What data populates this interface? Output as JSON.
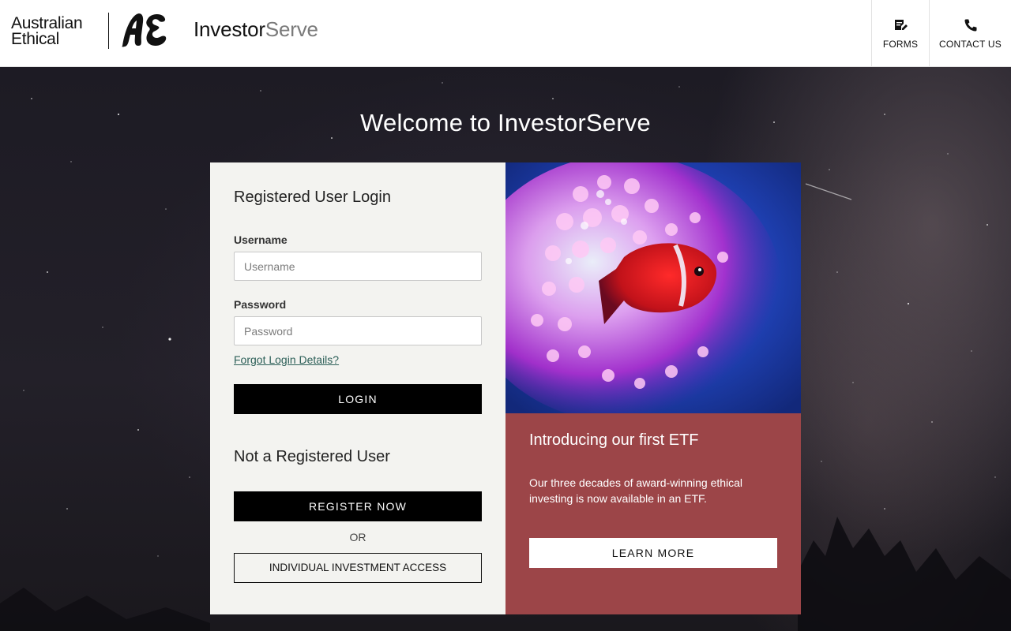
{
  "header": {
    "logo_line1": "Australian",
    "logo_line2": "Ethical",
    "product_name_part1": "Investor",
    "product_name_part2": "Serve",
    "nav": [
      {
        "label": "FORMS",
        "icon": "form-edit-icon"
      },
      {
        "label": "CONTACT US",
        "icon": "phone-icon"
      }
    ]
  },
  "main": {
    "welcome_title": "Welcome to InvestorServe"
  },
  "login": {
    "heading": "Registered User Login",
    "username_label": "Username",
    "username_placeholder": "Username",
    "username_value": "",
    "password_label": "Password",
    "password_placeholder": "Password",
    "password_value": "",
    "forgot_link": "Forgot Login Details?",
    "login_button": "LOGIN"
  },
  "register": {
    "heading": "Not a Registered User",
    "register_button": "REGISTER NOW",
    "or_text": "OR",
    "individual_access_button": "INDIVIDUAL INVESTMENT ACCESS"
  },
  "promo": {
    "title": "Introducing our first ETF",
    "body": "Our three decades of award-winning ethical investing is now available in an ETF.",
    "button": "LEARN MORE"
  },
  "colors": {
    "promo_background": "#9c4548",
    "login_panel_background": "#f3f3f0",
    "button_dark": "#000000",
    "link": "#2c5f58"
  }
}
